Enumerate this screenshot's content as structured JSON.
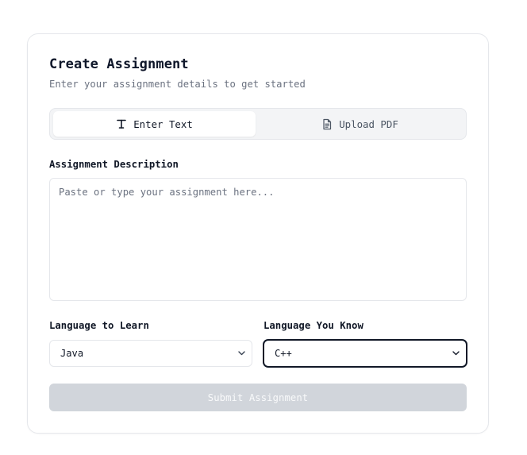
{
  "form": {
    "title": "Create Assignment",
    "subtitle": "Enter your assignment details to get started",
    "tabs": [
      {
        "label": "Enter Text",
        "icon": "text-icon",
        "active": true
      },
      {
        "label": "Upload PDF",
        "icon": "document-icon",
        "active": false
      }
    ],
    "description": {
      "label": "Assignment Description",
      "placeholder": "Paste or type your assignment here...",
      "value": ""
    },
    "language_to_learn": {
      "label": "Language to Learn",
      "value": "Java"
    },
    "language_you_know": {
      "label": "Language You Know",
      "value": "C++"
    },
    "submit_label": "Submit Assignment"
  },
  "colors": {
    "card_border": "#e5e7eb",
    "tab_background": "#f3f4f6",
    "submit_disabled_background": "#d1d5db",
    "focus_border": "#111827",
    "muted_text": "#6b7280"
  }
}
